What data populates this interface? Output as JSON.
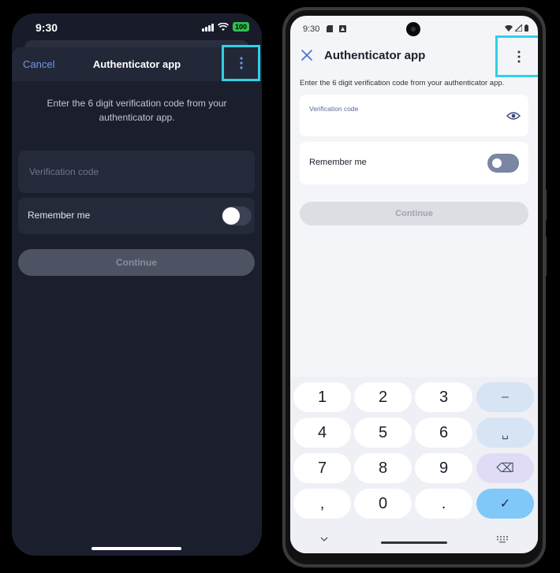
{
  "ios": {
    "status": {
      "time": "9:30",
      "battery": "100"
    },
    "header": {
      "cancel_label": "Cancel",
      "title": "Authenticator app"
    },
    "description": "Enter the 6 digit verification code from your authenticator app.",
    "verification_field": {
      "placeholder": "Verification code",
      "value": ""
    },
    "remember_me": {
      "label": "Remember me",
      "enabled": false
    },
    "continue_label": "Continue"
  },
  "android": {
    "status": {
      "time": "9:30"
    },
    "header": {
      "title": "Authenticator app"
    },
    "description": "Enter the 6 digit verification code from your authenticator app.",
    "verification_field": {
      "label": "Verification code",
      "value": ""
    },
    "remember_me": {
      "label": "Remember me",
      "enabled": false
    },
    "continue_label": "Continue",
    "keyboard": {
      "rows": [
        [
          "1",
          "2",
          "3",
          "–"
        ],
        [
          "4",
          "5",
          "6",
          "␣"
        ],
        [
          "7",
          "8",
          "9",
          "⌫"
        ],
        [
          ",",
          "0",
          ".",
          "✓"
        ]
      ]
    }
  },
  "colors": {
    "highlight": "#2ed1e6",
    "ios_background": "#181b29",
    "ios_link": "#6d97e8",
    "android_background": "#f4f5f8",
    "android_confirm_key": "#7fc8f8"
  }
}
